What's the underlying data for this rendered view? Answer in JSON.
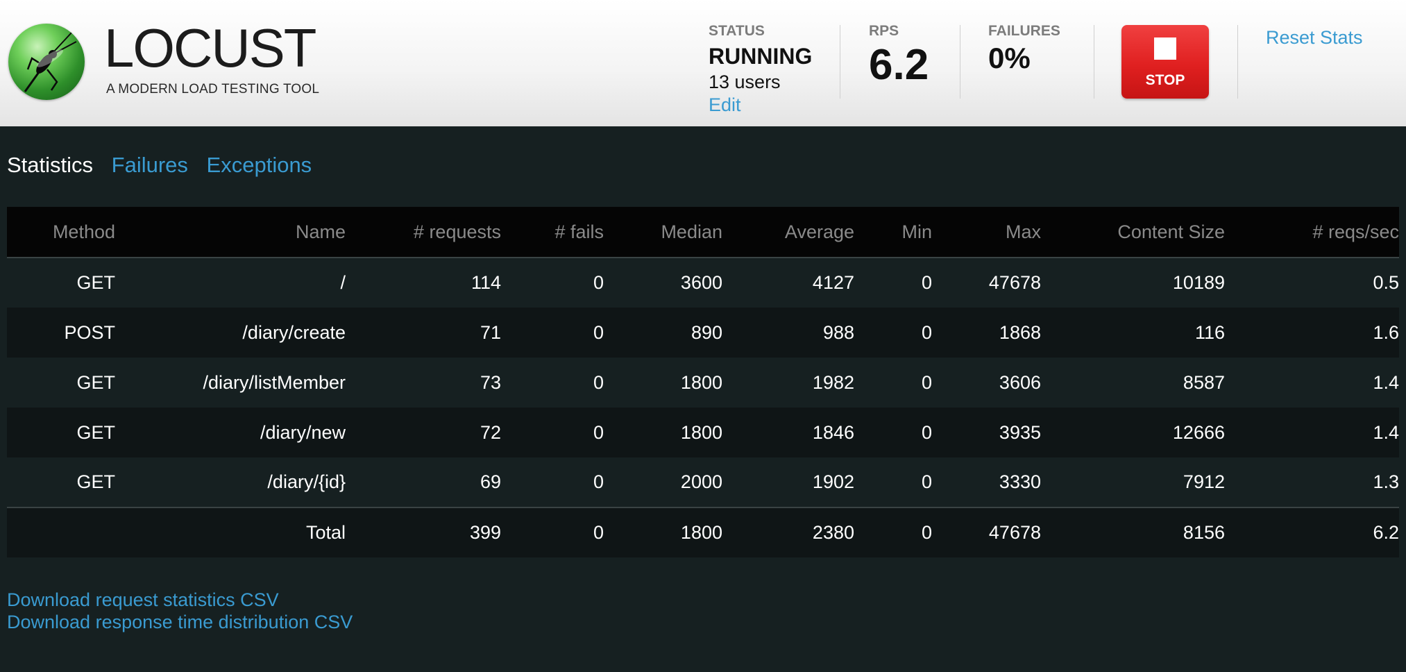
{
  "app": {
    "logo_text": "LOCUST",
    "tagline": "A MODERN LOAD TESTING TOOL"
  },
  "status": {
    "label": "STATUS",
    "value": "RUNNING",
    "users": "13 users",
    "edit_label": "Edit"
  },
  "rps": {
    "label": "RPS",
    "value": "6.2"
  },
  "failures": {
    "label": "FAILURES",
    "value": "0%"
  },
  "stop_button": {
    "label": "STOP"
  },
  "reset_stats": {
    "label": "Reset Stats"
  },
  "colors": {
    "accent_link": "#3a9bd1",
    "stop_red": "#e02020",
    "background": "#162021"
  },
  "tabs": [
    {
      "label": "Statistics",
      "active": true
    },
    {
      "label": "Failures",
      "active": false
    },
    {
      "label": "Exceptions",
      "active": false
    }
  ],
  "table": {
    "columns": [
      "Method",
      "Name",
      "# requests",
      "# fails",
      "Median",
      "Average",
      "Min",
      "Max",
      "Content Size",
      "# reqs/sec"
    ],
    "rows": [
      [
        "GET",
        "/",
        "114",
        "0",
        "3600",
        "4127",
        "0",
        "47678",
        "10189",
        "0.5"
      ],
      [
        "POST",
        "/diary/create",
        "71",
        "0",
        "890",
        "988",
        "0",
        "1868",
        "116",
        "1.6"
      ],
      [
        "GET",
        "/diary/listMember",
        "73",
        "0",
        "1800",
        "1982",
        "0",
        "3606",
        "8587",
        "1.4"
      ],
      [
        "GET",
        "/diary/new",
        "72",
        "0",
        "1800",
        "1846",
        "0",
        "3935",
        "12666",
        "1.4"
      ],
      [
        "GET",
        "/diary/{id}",
        "69",
        "0",
        "2000",
        "1902",
        "0",
        "3330",
        "7912",
        "1.3"
      ]
    ],
    "total": [
      "",
      "Total",
      "399",
      "0",
      "1800",
      "2380",
      "0",
      "47678",
      "8156",
      "6.2"
    ]
  },
  "downloads": {
    "request_stats": "Download request statistics CSV",
    "response_dist": "Download response time distribution CSV"
  }
}
